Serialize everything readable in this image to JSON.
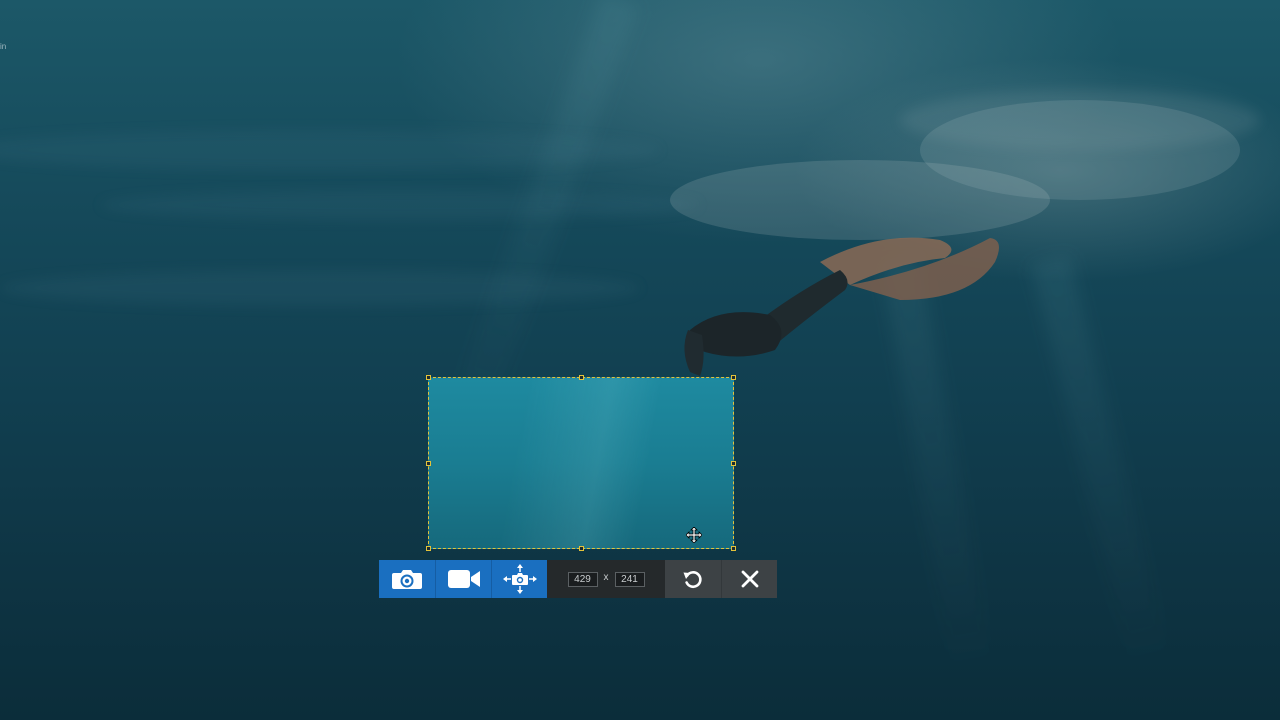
{
  "desktop": {
    "corner_text": "in"
  },
  "toolbar": {
    "screenshot_button": {
      "icon": "camera-icon"
    },
    "record_button": {
      "icon": "video-camera-icon"
    },
    "scroll_capture_button": {
      "icon": "move-camera-icon"
    },
    "width_value": "429",
    "height_value": "241",
    "separator": "x",
    "reset_button": {
      "icon": "undo-icon"
    },
    "close_button": {
      "icon": "close-icon"
    }
  },
  "colors": {
    "selection_border": "#e3c23a",
    "toolbar_blue": "#1a6fc0",
    "toolbar_dark": "#3d4245"
  }
}
